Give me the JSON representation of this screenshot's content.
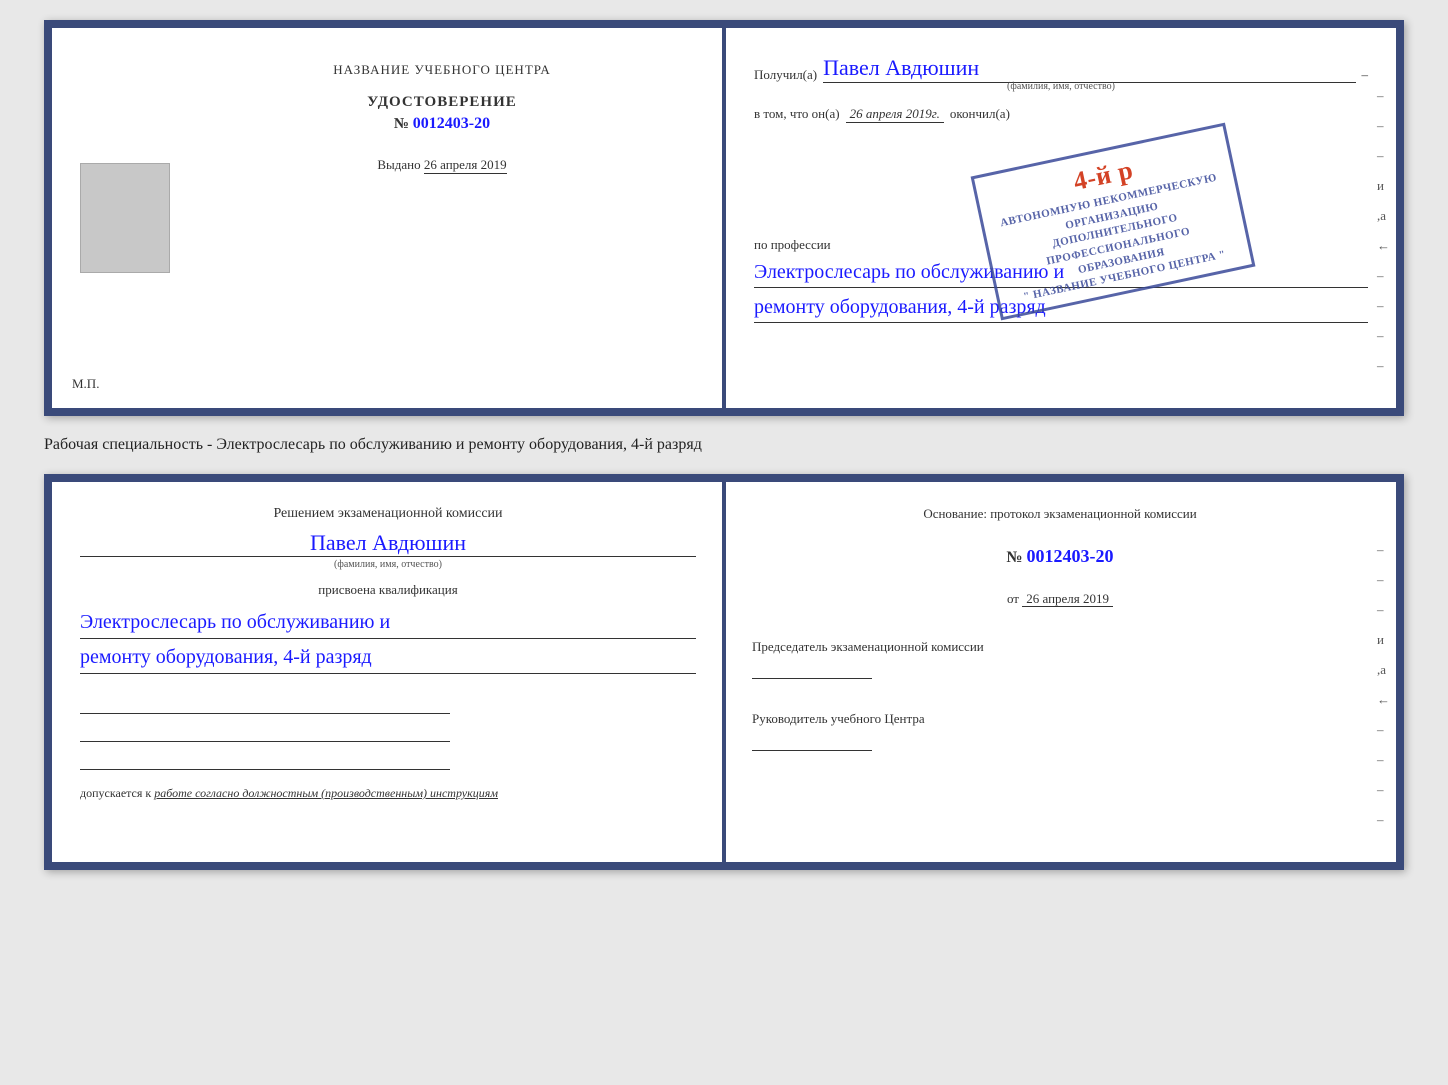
{
  "top_document": {
    "left_page": {
      "institution_title": "НАЗВАНИЕ УЧЕБНОГО ЦЕНТРА",
      "certificate_label": "УДОСТОВЕРЕНИЕ",
      "certificate_number_prefix": "№",
      "certificate_number": "0012403-20",
      "issued_label": "Выдано",
      "issued_date": "26 апреля 2019",
      "mp_label": "М.П."
    },
    "right_page": {
      "recipient_prefix": "Получил(а)",
      "recipient_name": "Павел Авдюшин",
      "recipient_sub": "(фамилия, имя, отчество)",
      "confirmation_prefix": "в том, что он(а)",
      "confirmation_date": "26 апреля 2019г.",
      "confirmation_suffix": "окончил(а)",
      "stamp_line1": "АВТОНОМНУЮ НЕКОММЕРЧЕСКУЮ ОРГАНИЗАЦИЮ",
      "stamp_line2": "ДОПОЛНИТЕЛЬНОГО ПРОФЕССИОНАЛЬНОГО ОБРАЗОВАНИЯ",
      "stamp_line3": "\" НАЗВАНИЕ УЧЕБНОГО ЦЕНТРА \"",
      "stamp_number": "4-й р",
      "profession_label": "по профессии",
      "profession_text_line1": "Электрослесарь по обслуживанию и",
      "profession_text_line2": "ремонту оборудования, 4-й разряд"
    }
  },
  "specialty_text": "Рабочая специальность - Электрослесарь по обслуживанию и ремонту оборудования, 4-й разряд",
  "bottom_document": {
    "left_page": {
      "commission_title": "Решением экзаменационной комиссии",
      "person_name": "Павел Авдюшин",
      "person_name_sub": "(фамилия, имя, отчество)",
      "qualification_label": "присвоена квалификация",
      "qualification_line1": "Электрослесарь по обслуживанию и",
      "qualification_line2": "ремонту оборудования, 4-й разряд",
      "allowed_prefix": "допускается к",
      "allowed_text": "работе согласно должностным (производственным) инструкциям"
    },
    "right_page": {
      "basis_label": "Основание: протокол экзаменационной комиссии",
      "number_prefix": "№",
      "basis_number": "0012403-20",
      "date_prefix": "от",
      "basis_date": "26 апреля 2019",
      "chairman_title": "Председатель экзаменационной комиссии",
      "director_title": "Руководитель учебного Центра"
    }
  },
  "side_dashes": [
    " –",
    " –",
    " –",
    " и",
    " ,а",
    " ←",
    " –",
    " –",
    " –",
    " –"
  ]
}
